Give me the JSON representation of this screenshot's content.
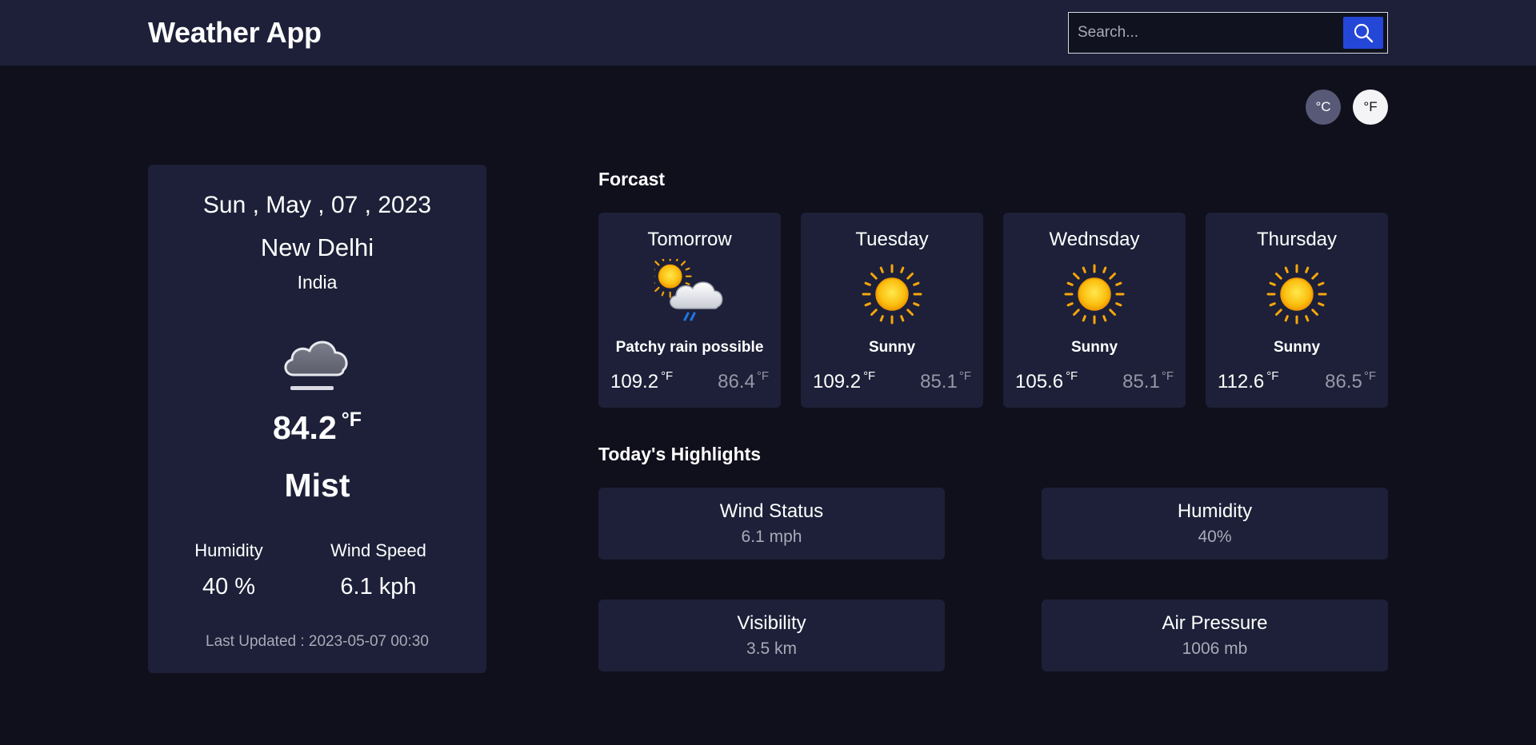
{
  "header": {
    "app_title": "Weather App",
    "search_placeholder": "Search..."
  },
  "units": {
    "celsius": "°C",
    "fahrenheit": "°F",
    "selected": "fahrenheit"
  },
  "current": {
    "date": "Sun , May , 07 , 2023",
    "city": "New Delhi",
    "country": "India",
    "icon": "mist-icon",
    "temperature": "84.2",
    "temperature_unit": "°F",
    "condition": "Mist",
    "humidity_label": "Humidity",
    "humidity_value": "40 %",
    "wind_label": "Wind Speed",
    "wind_value": "6.1 kph",
    "last_updated": "Last Updated : 2023-05-07 00:30"
  },
  "forecast": {
    "title": "Forcast",
    "days": [
      {
        "day": "Tomorrow",
        "icon": "patchy-rain-icon",
        "condition": "Patchy rain possible",
        "max": "109.2",
        "max_unit": "°F",
        "min": "86.4",
        "min_unit": "°F"
      },
      {
        "day": "Tuesday",
        "icon": "sun-icon",
        "condition": "Sunny",
        "max": "109.2",
        "max_unit": "°F",
        "min": "85.1",
        "min_unit": "°F"
      },
      {
        "day": "Wednsday",
        "icon": "sun-icon",
        "condition": "Sunny",
        "max": "105.6",
        "max_unit": "°F",
        "min": "85.1",
        "min_unit": "°F"
      },
      {
        "day": "Thursday",
        "icon": "sun-icon",
        "condition": "Sunny",
        "max": "112.6",
        "max_unit": "°F",
        "min": "86.5",
        "min_unit": "°F"
      }
    ]
  },
  "highlights": {
    "title": "Today's Highlights",
    "items": [
      {
        "label": "Wind Status",
        "value": "6.1 mph"
      },
      {
        "label": "Humidity",
        "value": "40%"
      },
      {
        "label": "Visibility",
        "value": "3.5 km"
      },
      {
        "label": "Air Pressure",
        "value": "1006 mb"
      }
    ]
  },
  "colors": {
    "background": "#100f1c",
    "card": "#1d2038",
    "accent": "#2447d8",
    "muted_text": "#a9aab8"
  }
}
